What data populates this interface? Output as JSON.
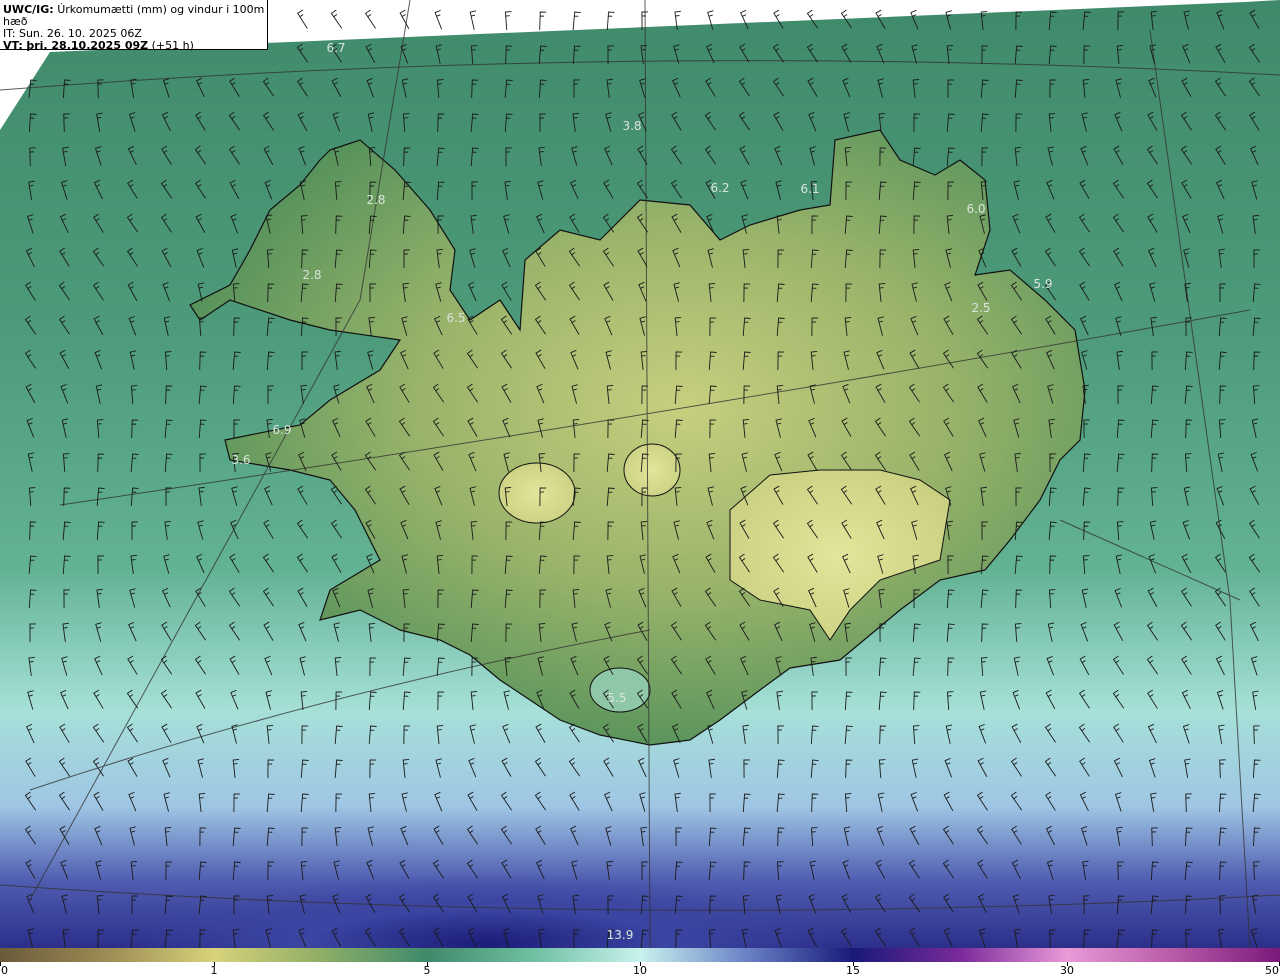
{
  "title": {
    "product": "UWC/IG:",
    "description": "Úrkomumætti (mm) og vindur i 100m hæð",
    "initial_time": "IT: Sun. 26. 10. 2025 06Z",
    "valid_prefix": "VT:",
    "valid_bold": "þri. 28.10.2025 09Z",
    "valid_suffix": "(+51 h)"
  },
  "colors": {
    "ocean_north": "#3c8a6c",
    "ocean_mid": "#5aa98a",
    "land_low": "#4f8f5a",
    "land_high": "#c9d27e",
    "ocean_south_light": "#a8e4df",
    "ocean_south_deep": "#2a2e8c",
    "coastline": "#111111",
    "grid": "#333333",
    "barb": "#1a1a1a"
  },
  "value_labels": [
    "6.7",
    "3.8",
    "6.2",
    "6.1",
    "6.0",
    "5.9",
    "2.8",
    "2.8",
    "6.5",
    "2.5",
    "6.9",
    "3.6",
    "5.5",
    "13.9"
  ],
  "colorbar": {
    "ticks": [
      "0",
      "1",
      "5",
      "10",
      "15",
      "30",
      "50"
    ]
  },
  "wind_barb_icon": "wind-barb-icon"
}
